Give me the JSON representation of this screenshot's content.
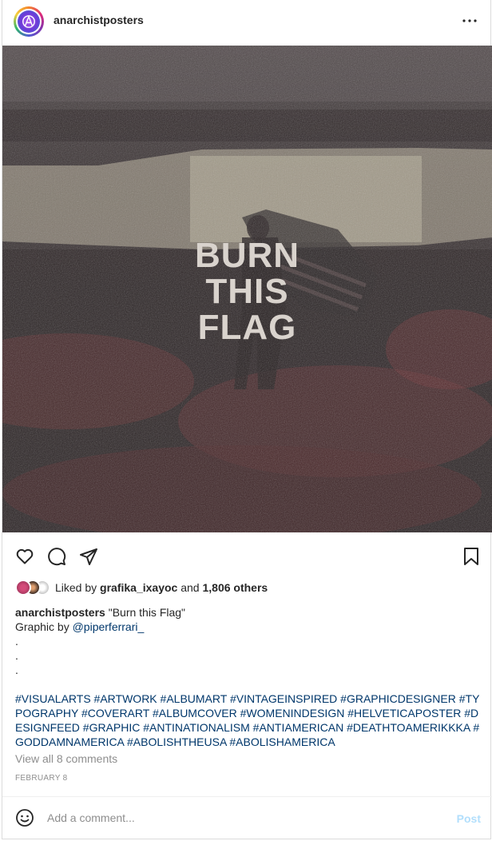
{
  "post": {
    "username": "anarchistposters",
    "media": {
      "title_lines": [
        "BURN",
        "THIS",
        "FLAG"
      ]
    },
    "likes": {
      "prefix": "Liked by",
      "user": "grafika_ixayoc",
      "connector": "and",
      "others": "1,806 others"
    },
    "caption": {
      "author": "anarchistposters",
      "text": "\"Burn this Flag\"",
      "credit_prefix": "Graphic by",
      "credit_handle": "@piperferrari_",
      "dots": [
        ".",
        ".",
        "."
      ],
      "hashtags": "#VISUALARTS #ARTWORK #ALBUMART #VINTAGEINSPIRED #GRAPHICDESIGNER #TYPOGRAPHY #COVERART #ALBUMCOVER #WOMENINDESIGN #HELVETICAPOSTER #DESIGNFEED #GRAPHIC #ANTINATIONALISM #ANTIAMERICAN #DEATHTOAMERIKKKA #GODDAMNAMERICA #ABOLISHTHEUSA #ABOLISHAMERICA"
    },
    "view_comments": "View all 8 comments",
    "date": "FEBRUARY 8",
    "comment": {
      "placeholder": "Add a comment...",
      "post_label": "Post"
    }
  },
  "icons": {
    "more": "more-horizontal-icon",
    "like": "heart-icon",
    "comment": "speech-bubble-icon",
    "share": "paper-plane-icon",
    "save": "bookmark-icon",
    "emoji": "smiley-icon"
  },
  "colors": {
    "link": "#00376b",
    "muted": "#8e8e8e",
    "post_button_disabled": "#b2dffc",
    "text": "#262626"
  }
}
